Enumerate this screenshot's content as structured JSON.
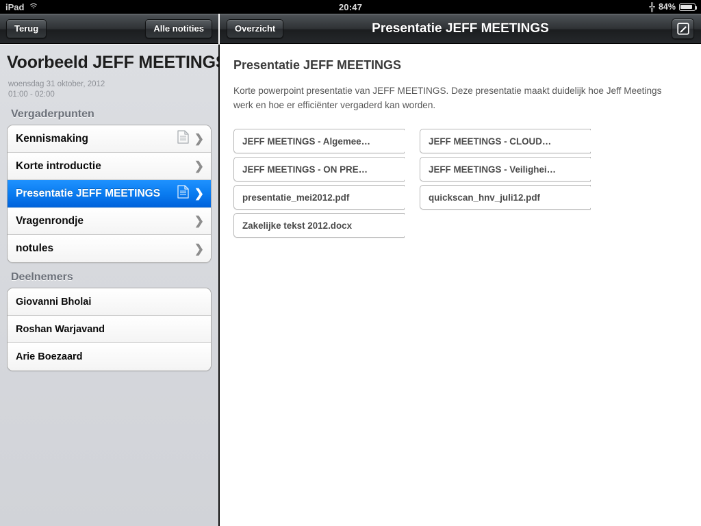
{
  "statusbar": {
    "device": "iPad",
    "wifi_icon": "wifi-icon",
    "time": "20:47",
    "bluetooth_icon": "bluetooth-icon",
    "battery_percent": "84%",
    "battery_level": 84,
    "battery_icon": "battery-icon"
  },
  "left_toolbar": {
    "back_label": "Terug",
    "all_notes_label": "Alle notities"
  },
  "right_toolbar": {
    "overview_label": "Overzicht",
    "title": "Presentatie JEFF MEETINGS",
    "compose_icon": "compose-icon"
  },
  "sidebar": {
    "note_title": "Voorbeeld JEFF MEETINGS",
    "note_date": "woensdag 31 oktober, 2012",
    "note_time": "01:00 - 02:00",
    "agenda_header": "Vergaderpunten",
    "agenda_items": [
      {
        "label": "Kennismaking",
        "has_document": true,
        "selected": false
      },
      {
        "label": "Korte introductie",
        "has_document": false,
        "selected": false
      },
      {
        "label": "Presentatie JEFF MEETINGS",
        "has_document": true,
        "selected": true
      },
      {
        "label": "Vragenrondje",
        "has_document": false,
        "selected": false
      },
      {
        "label": "notules",
        "has_document": false,
        "selected": false
      }
    ],
    "participants_header": "Deelnemers",
    "participants": [
      {
        "label": "Giovanni Bholai"
      },
      {
        "label": "Roshan Warjavand"
      },
      {
        "label": "Arie Boezaard"
      }
    ]
  },
  "detail": {
    "title": "Presentatie JEFF MEETINGS",
    "body": "Korte powerpoint presentatie van JEFF MEETINGS. Deze presentatie maakt duidelijk hoe Jeff Meetings werk en hoe er efficiënter vergaderd kan worden.",
    "attachment_columns": [
      [
        {
          "label": "JEFF MEETINGS - Algemee…"
        },
        {
          "label": "JEFF MEETINGS - ON PRE…"
        },
        {
          "label": "presentatie_mei2012.pdf"
        },
        {
          "label": "Zakelijke tekst 2012.docx"
        }
      ],
      [
        {
          "label": "JEFF MEETINGS - CLOUD…"
        },
        {
          "label": "JEFF MEETINGS - Veilighei…"
        },
        {
          "label": "quickscan_hnv_juli12.pdf"
        }
      ]
    ]
  },
  "colors": {
    "selection_blue": "#0a7cf0",
    "toolbar_dark": "#2e3134",
    "sidebar_bg": "#d5d7dc",
    "section_header": "#6b7079"
  }
}
